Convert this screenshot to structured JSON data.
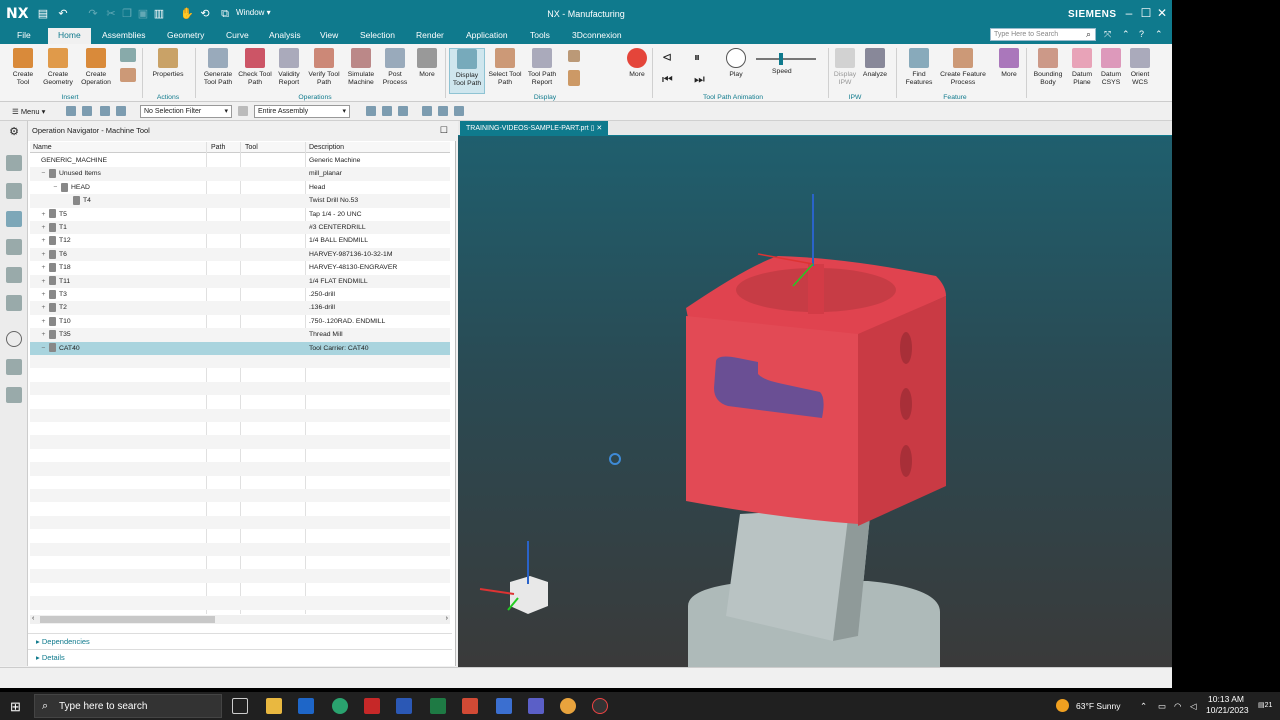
{
  "titlebar": {
    "logo": "NX",
    "window_label": "Window",
    "title": "NX - Manufacturing",
    "brand": "SIEMENS"
  },
  "menu": {
    "tabs": [
      "File",
      "Home",
      "Assemblies",
      "Geometry",
      "Curve",
      "Analysis",
      "View",
      "Selection",
      "Render",
      "Application",
      "Tools",
      "3Dconnexion"
    ],
    "active": "Home",
    "search_placeholder": "Type Here to Search"
  },
  "ribbon": {
    "buttons": {
      "create_tool": "Create Tool",
      "create_geometry": "Create Geometry",
      "create_operation": "Create Operation",
      "properties": "Properties",
      "generate_tool_path": "Generate Tool Path",
      "check_tool_path": "Check Tool Path",
      "validity_report": "Validity Report",
      "verify_tool_path": "Verify Tool Path",
      "simulate_machine": "Simulate Machine",
      "post_process": "Post Process",
      "more_ops": "More",
      "display_tool_path": "Display Tool Path",
      "select_tool_path": "Select Tool Path",
      "tool_path_report": "Tool Path Report",
      "more_display": "More",
      "play": "Play",
      "speed": "Speed",
      "display_ipw": "Display IPW",
      "analyze": "Analyze",
      "find_features": "Find Features",
      "create_feature_process": "Create Feature Process",
      "more_feature": "More",
      "bounding_body": "Bounding Body",
      "datum_plane": "Datum Plane",
      "datum_csys": "Datum CSYS",
      "orient_wcs": "Orient WCS"
    },
    "groups": {
      "insert": "Insert",
      "actions": "Actions",
      "operations": "Operations",
      "display": "Display",
      "animation": "Tool Path Animation",
      "ipw": "IPW",
      "feature": "Feature"
    }
  },
  "toolbar2": {
    "menu_label": "Menu",
    "selection_filter": "No Selection Filter",
    "scope": "Entire Assembly"
  },
  "navigator": {
    "title": "Operation Navigator - Machine Tool",
    "columns": [
      "Name",
      "Path",
      "Tool",
      "Description"
    ],
    "rows": [
      {
        "name": "GENERIC_MACHINE",
        "desc": "Generic Machine"
      },
      {
        "name": "Unused Items",
        "desc": "mill_planar"
      },
      {
        "name": "HEAD",
        "desc": "Head"
      },
      {
        "name": "T4",
        "desc": "Twist Drill No.53"
      },
      {
        "name": "T5",
        "desc": "Tap 1/4 - 20 UNC"
      },
      {
        "name": "T1",
        "desc": "#3 CENTERDRILL"
      },
      {
        "name": "T12",
        "desc": "1/4 BALL ENDMILL"
      },
      {
        "name": "T6",
        "desc": "HARVEY-987136-10-32-1M"
      },
      {
        "name": "T18",
        "desc": "HARVEY-48130-ENGRAVER"
      },
      {
        "name": "T11",
        "desc": "1/4 FLAT ENDMILL"
      },
      {
        "name": "T3",
        "desc": ".250-drill"
      },
      {
        "name": "T2",
        "desc": ".136-drill"
      },
      {
        "name": "T10",
        "desc": ".750-.120RAD. ENDMILL"
      },
      {
        "name": "T35",
        "desc": "Thread Mill"
      },
      {
        "name": "CAT40",
        "desc": "Tool Carrier: CAT40"
      }
    ],
    "dependencies": "Dependencies",
    "details": "Details"
  },
  "graphics": {
    "tab": "TRAINING-VIDEOS-SAMPLE-PART.prt"
  },
  "taskbar": {
    "search": "Type here to search",
    "weather": "63°F  Sunny",
    "time": "10:13 AM",
    "date": "10/21/2023",
    "notif": "21"
  },
  "colors": {
    "accent": "#0f7a8d",
    "part_red": "#e0434f",
    "part_gray": "#b9c3c3",
    "selection": "#a9d4de"
  }
}
